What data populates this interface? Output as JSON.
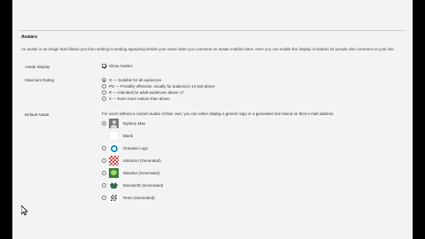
{
  "section": {
    "title": "Avatars",
    "intro": "An avatar is an image that follows you from weblog to weblog appearing beside your name when you comment on avatar enabled sites. Here you can enable the display of avatars for people who comment on your site."
  },
  "avatar_display": {
    "label": "Avatar Display",
    "checkbox_label": "Show Avatars",
    "checked": true
  },
  "maximum_rating": {
    "label": "Maximum Rating",
    "options": [
      {
        "text": "G — Suitable for all audiences",
        "selected": true
      },
      {
        "text": "PG — Possibly offensive, usually for audiences 13 and above",
        "selected": false
      },
      {
        "text": "R — Intended for adult audiences above 17",
        "selected": false
      },
      {
        "text": "X — Even more mature than above",
        "selected": false
      }
    ]
  },
  "default_avatar": {
    "label": "Default Avatar",
    "description": "For users without a custom avatar of their own, you can either display a generic logo or a generated one based on their e-mail address.",
    "options": [
      {
        "text": "Mystery Man",
        "icon": "mystery-man-icon",
        "selected": true
      },
      {
        "text": "Blank",
        "icon": "blank-icon",
        "selected": false
      },
      {
        "text": "Gravatar Logo",
        "icon": "gravatar-logo-icon",
        "selected": false
      },
      {
        "text": "Identicon (Generated)",
        "icon": "identicon-icon",
        "selected": false
      },
      {
        "text": "Wavatar (Generated)",
        "icon": "wavatar-icon",
        "selected": false
      },
      {
        "text": "MonsterID (Generated)",
        "icon": "monsterid-icon",
        "selected": false
      },
      {
        "text": "Retro (Generated)",
        "icon": "retro-icon",
        "selected": false
      }
    ]
  }
}
